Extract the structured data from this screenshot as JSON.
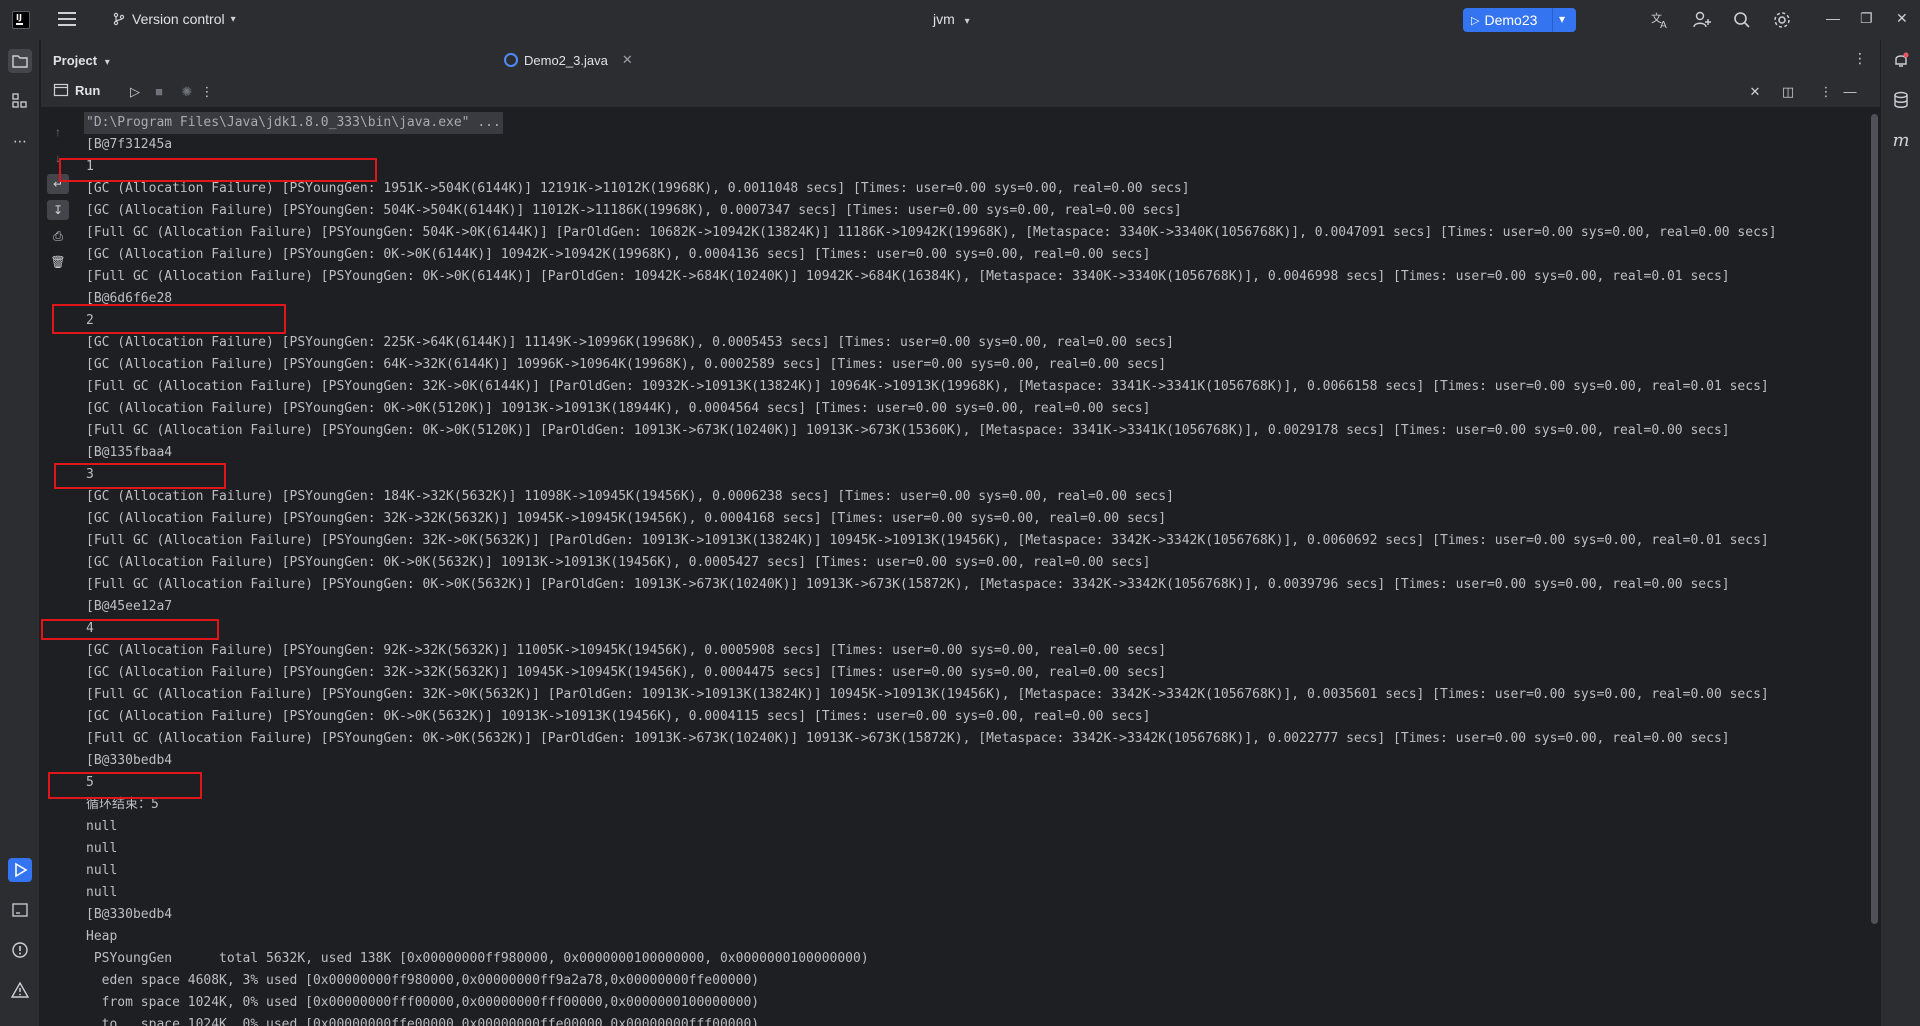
{
  "titlebar": {
    "logo_text": "IJ",
    "version_control": "Version control",
    "project_name": "jvm",
    "run_config": "Demo23"
  },
  "project_panel": {
    "title": "Project"
  },
  "editor_tab": {
    "label": "Demo2_3.java"
  },
  "run_panel": {
    "tab_label": "Run"
  },
  "console": {
    "lines": [
      "\"D:\\Program Files\\Java\\jdk1.8.0_333\\bin\\java.exe\" ...",
      "[B@7f31245a",
      "1",
      "[GC (Allocation Failure) [PSYoungGen: 1951K->504K(6144K)] 12191K->11012K(19968K), 0.0011048 secs] [Times: user=0.00 sys=0.00, real=0.00 secs]",
      "[GC (Allocation Failure) [PSYoungGen: 504K->504K(6144K)] 11012K->11186K(19968K), 0.0007347 secs] [Times: user=0.00 sys=0.00, real=0.00 secs]",
      "[Full GC (Allocation Failure) [PSYoungGen: 504K->0K(6144K)] [ParOldGen: 10682K->10942K(13824K)] 11186K->10942K(19968K), [Metaspace: 3340K->3340K(1056768K)], 0.0047091 secs] [Times: user=0.00 sys=0.00, real=0.00 secs]",
      "[GC (Allocation Failure) [PSYoungGen: 0K->0K(6144K)] 10942K->10942K(19968K), 0.0004136 secs] [Times: user=0.00 sys=0.00, real=0.00 secs]",
      "[Full GC (Allocation Failure) [PSYoungGen: 0K->0K(6144K)] [ParOldGen: 10942K->684K(10240K)] 10942K->684K(16384K), [Metaspace: 3340K->3340K(1056768K)], 0.0046998 secs] [Times: user=0.00 sys=0.00, real=0.01 secs]",
      "[B@6d6f6e28",
      "2",
      "[GC (Allocation Failure) [PSYoungGen: 225K->64K(6144K)] 11149K->10996K(19968K), 0.0005453 secs] [Times: user=0.00 sys=0.00, real=0.00 secs]",
      "[GC (Allocation Failure) [PSYoungGen: 64K->32K(6144K)] 10996K->10964K(19968K), 0.0002589 secs] [Times: user=0.00 sys=0.00, real=0.00 secs]",
      "[Full GC (Allocation Failure) [PSYoungGen: 32K->0K(6144K)] [ParOldGen: 10932K->10913K(13824K)] 10964K->10913K(19968K), [Metaspace: 3341K->3341K(1056768K)], 0.0066158 secs] [Times: user=0.00 sys=0.00, real=0.01 secs]",
      "[GC (Allocation Failure) [PSYoungGen: 0K->0K(5120K)] 10913K->10913K(18944K), 0.0004564 secs] [Times: user=0.00 sys=0.00, real=0.00 secs]",
      "[Full GC (Allocation Failure) [PSYoungGen: 0K->0K(5120K)] [ParOldGen: 10913K->673K(10240K)] 10913K->673K(15360K), [Metaspace: 3341K->3341K(1056768K)], 0.0029178 secs] [Times: user=0.00 sys=0.00, real=0.00 secs]",
      "[B@135fbaa4",
      "3",
      "[GC (Allocation Failure) [PSYoungGen: 184K->32K(5632K)] 11098K->10945K(19456K), 0.0006238 secs] [Times: user=0.00 sys=0.00, real=0.00 secs]",
      "[GC (Allocation Failure) [PSYoungGen: 32K->32K(5632K)] 10945K->10945K(19456K), 0.0004168 secs] [Times: user=0.00 sys=0.00, real=0.00 secs]",
      "[Full GC (Allocation Failure) [PSYoungGen: 32K->0K(5632K)] [ParOldGen: 10913K->10913K(13824K)] 10945K->10913K(19456K), [Metaspace: 3342K->3342K(1056768K)], 0.0060692 secs] [Times: user=0.00 sys=0.00, real=0.01 secs]",
      "[GC (Allocation Failure) [PSYoungGen: 0K->0K(5632K)] 10913K->10913K(19456K), 0.0005427 secs] [Times: user=0.00 sys=0.00, real=0.00 secs]",
      "[Full GC (Allocation Failure) [PSYoungGen: 0K->0K(5632K)] [ParOldGen: 10913K->673K(10240K)] 10913K->673K(15872K), [Metaspace: 3342K->3342K(1056768K)], 0.0039796 secs] [Times: user=0.00 sys=0.00, real=0.00 secs]",
      "[B@45ee12a7",
      "4",
      "[GC (Allocation Failure) [PSYoungGen: 92K->32K(5632K)] 11005K->10945K(19456K), 0.0005908 secs] [Times: user=0.00 sys=0.00, real=0.00 secs]",
      "[GC (Allocation Failure) [PSYoungGen: 32K->32K(5632K)] 10945K->10945K(19456K), 0.0004475 secs] [Times: user=0.00 sys=0.00, real=0.00 secs]",
      "[Full GC (Allocation Failure) [PSYoungGen: 32K->0K(5632K)] [ParOldGen: 10913K->10913K(13824K)] 10945K->10913K(19456K), [Metaspace: 3342K->3342K(1056768K)], 0.0035601 secs] [Times: user=0.00 sys=0.00, real=0.00 secs]",
      "[GC (Allocation Failure) [PSYoungGen: 0K->0K(5632K)] 10913K->10913K(19456K), 0.0004115 secs] [Times: user=0.00 sys=0.00, real=0.00 secs]",
      "[Full GC (Allocation Failure) [PSYoungGen: 0K->0K(5632K)] [ParOldGen: 10913K->673K(10240K)] 10913K->673K(15872K), [Metaspace: 3342K->3342K(1056768K)], 0.0022777 secs] [Times: user=0.00 sys=0.00, real=0.00 secs]",
      "[B@330bedb4",
      "5",
      "循环结束：5",
      "null",
      "null",
      "null",
      "null",
      "[B@330bedb4",
      "Heap",
      " PSYoungGen      total 5632K, used 138K [0x00000000ff980000, 0x0000000100000000, 0x0000000100000000)",
      "  eden space 4608K, 3% used [0x00000000ff980000,0x00000000ff9a2a78,0x00000000ffe00000)",
      "  from space 1024K, 0% used [0x00000000fff00000,0x00000000fff00000,0x0000000100000000)",
      "  to   space 1024K, 0% used [0x00000000ffe00000,0x00000000ffe00000,0x00000000fff00000)"
    ]
  },
  "colors": {
    "accent": "#3574f0",
    "highlight_box": "#e0161b",
    "background": "#1e1f22",
    "panel": "#2b2d30"
  }
}
